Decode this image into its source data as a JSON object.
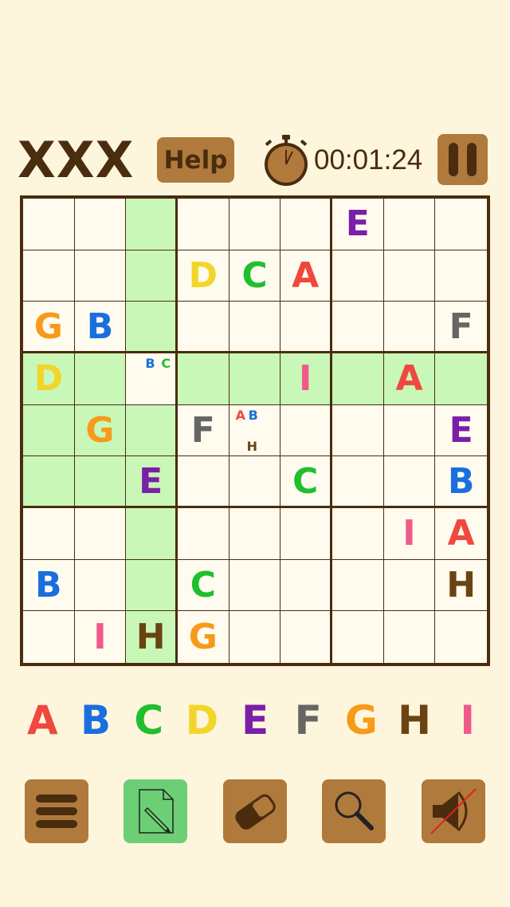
{
  "header": {
    "title": "XXX",
    "help_label": "Help",
    "timer": "00:01:24"
  },
  "colors": {
    "A": "#f0483e",
    "B": "#1a6fdf",
    "C": "#1fbf2e",
    "D": "#f2d52a",
    "E": "#7a1fa8",
    "F": "#666666",
    "G": "#f79a1a",
    "H": "#6b4312",
    "I": "#ee5a8a",
    "accent_brown": "#b07a3c",
    "highlight_green": "#c8f7b8"
  },
  "board": {
    "rows": [
      [
        "",
        "",
        "",
        "",
        "",
        "",
        "E",
        "",
        ""
      ],
      [
        "",
        "",
        "",
        "D",
        "C",
        "A",
        "",
        "",
        ""
      ],
      [
        "G",
        "B",
        "",
        "",
        "",
        "",
        "",
        "",
        "F"
      ],
      [
        "D",
        "",
        "",
        "",
        "",
        "I",
        "",
        "A",
        ""
      ],
      [
        "",
        "G",
        "",
        "F",
        "",
        "",
        "",
        "",
        "E"
      ],
      [
        "",
        "",
        "E",
        "",
        "",
        "C",
        "",
        "",
        "B"
      ],
      [
        "",
        "",
        "",
        "",
        "",
        "",
        "",
        "I",
        "A"
      ],
      [
        "B",
        "",
        "",
        "C",
        "",
        "",
        "",
        "",
        "H"
      ],
      [
        "",
        "I",
        "H",
        "G",
        "",
        "",
        "",
        "",
        ""
      ]
    ],
    "notes": [
      {
        "row": 3,
        "col": 2,
        "letters": [
          "B",
          "C"
        ]
      },
      {
        "row": 4,
        "col": 4,
        "letters": [
          "A",
          "B",
          "H"
        ]
      }
    ],
    "selected": {
      "row": 3,
      "col": 2
    }
  },
  "letter_picker": [
    "A",
    "B",
    "C",
    "D",
    "E",
    "F",
    "G",
    "H",
    "I"
  ],
  "toolbar": {
    "icons": [
      "menu-icon",
      "pencil-notes-icon",
      "eraser-icon",
      "magnifier-icon",
      "sound-muted-icon"
    ]
  }
}
